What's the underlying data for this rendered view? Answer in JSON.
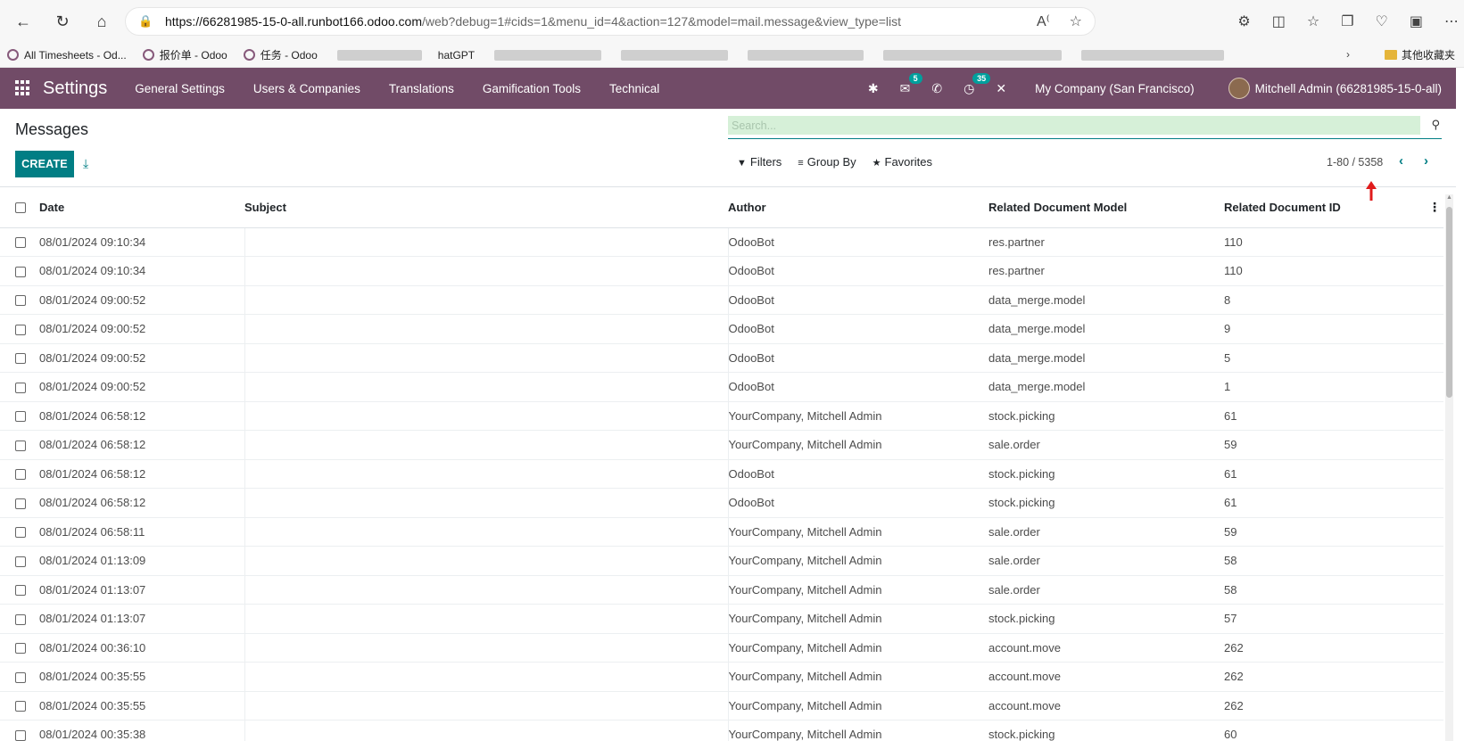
{
  "browser": {
    "url_host": "https://66281985-15-0-all.runbot166.odoo.com",
    "url_rest": "/web?debug=1#cids=1&menu_id=4&action=127&model=mail.message&view_type=list",
    "bookmarks": [
      "All Timesheets - Od...",
      "报价单 - Odoo",
      "任务 - Odoo",
      "hatGPT"
    ],
    "other_favorites": "其他收藏夹"
  },
  "navbar": {
    "app_name": "Settings",
    "menu": [
      "General Settings",
      "Users & Companies",
      "Translations",
      "Gamification Tools",
      "Technical"
    ],
    "messages_badge": "5",
    "activities_badge": "35",
    "company": "My Company (San Francisco)",
    "user": "Mitchell Admin (66281985-15-0-all)"
  },
  "control": {
    "title": "Messages",
    "create_label": "CREATE",
    "search_placeholder": "Search...",
    "filters_label": "Filters",
    "groupby_label": "Group By",
    "favorites_label": "Favorites",
    "pager": "1-80 / 5358"
  },
  "table": {
    "columns": [
      "Date",
      "Subject",
      "Author",
      "Related Document Model",
      "Related Document ID"
    ],
    "rows": [
      {
        "date": "08/01/2024 09:10:34",
        "subject": "",
        "author": "OdooBot",
        "model": "res.partner",
        "res_id": "110"
      },
      {
        "date": "08/01/2024 09:10:34",
        "subject": "",
        "author": "OdooBot",
        "model": "res.partner",
        "res_id": "110"
      },
      {
        "date": "08/01/2024 09:00:52",
        "subject": "",
        "author": "OdooBot",
        "model": "data_merge.model",
        "res_id": "8"
      },
      {
        "date": "08/01/2024 09:00:52",
        "subject": "",
        "author": "OdooBot",
        "model": "data_merge.model",
        "res_id": "9"
      },
      {
        "date": "08/01/2024 09:00:52",
        "subject": "",
        "author": "OdooBot",
        "model": "data_merge.model",
        "res_id": "5"
      },
      {
        "date": "08/01/2024 09:00:52",
        "subject": "",
        "author": "OdooBot",
        "model": "data_merge.model",
        "res_id": "1"
      },
      {
        "date": "08/01/2024 06:58:12",
        "subject": "",
        "author": "YourCompany, Mitchell Admin",
        "model": "stock.picking",
        "res_id": "61"
      },
      {
        "date": "08/01/2024 06:58:12",
        "subject": "",
        "author": "YourCompany, Mitchell Admin",
        "model": "sale.order",
        "res_id": "59"
      },
      {
        "date": "08/01/2024 06:58:12",
        "subject": "",
        "author": "OdooBot",
        "model": "stock.picking",
        "res_id": "61"
      },
      {
        "date": "08/01/2024 06:58:12",
        "subject": "",
        "author": "OdooBot",
        "model": "stock.picking",
        "res_id": "61"
      },
      {
        "date": "08/01/2024 06:58:11",
        "subject": "",
        "author": "YourCompany, Mitchell Admin",
        "model": "sale.order",
        "res_id": "59"
      },
      {
        "date": "08/01/2024 01:13:09",
        "subject": "",
        "author": "YourCompany, Mitchell Admin",
        "model": "sale.order",
        "res_id": "58"
      },
      {
        "date": "08/01/2024 01:13:07",
        "subject": "",
        "author": "YourCompany, Mitchell Admin",
        "model": "sale.order",
        "res_id": "58"
      },
      {
        "date": "08/01/2024 01:13:07",
        "subject": "",
        "author": "YourCompany, Mitchell Admin",
        "model": "stock.picking",
        "res_id": "57"
      },
      {
        "date": "08/01/2024 00:36:10",
        "subject": "",
        "author": "YourCompany, Mitchell Admin",
        "model": "account.move",
        "res_id": "262"
      },
      {
        "date": "08/01/2024 00:35:55",
        "subject": "",
        "author": "YourCompany, Mitchell Admin",
        "model": "account.move",
        "res_id": "262"
      },
      {
        "date": "08/01/2024 00:35:55",
        "subject": "",
        "author": "YourCompany, Mitchell Admin",
        "model": "account.move",
        "res_id": "262"
      },
      {
        "date": "08/01/2024 00:35:38",
        "subject": "",
        "author": "YourCompany, Mitchell Admin",
        "model": "stock.picking",
        "res_id": "60"
      }
    ]
  },
  "colors": {
    "navbar": "#714b67",
    "primary": "#017e84",
    "badge": "#00a09d"
  }
}
